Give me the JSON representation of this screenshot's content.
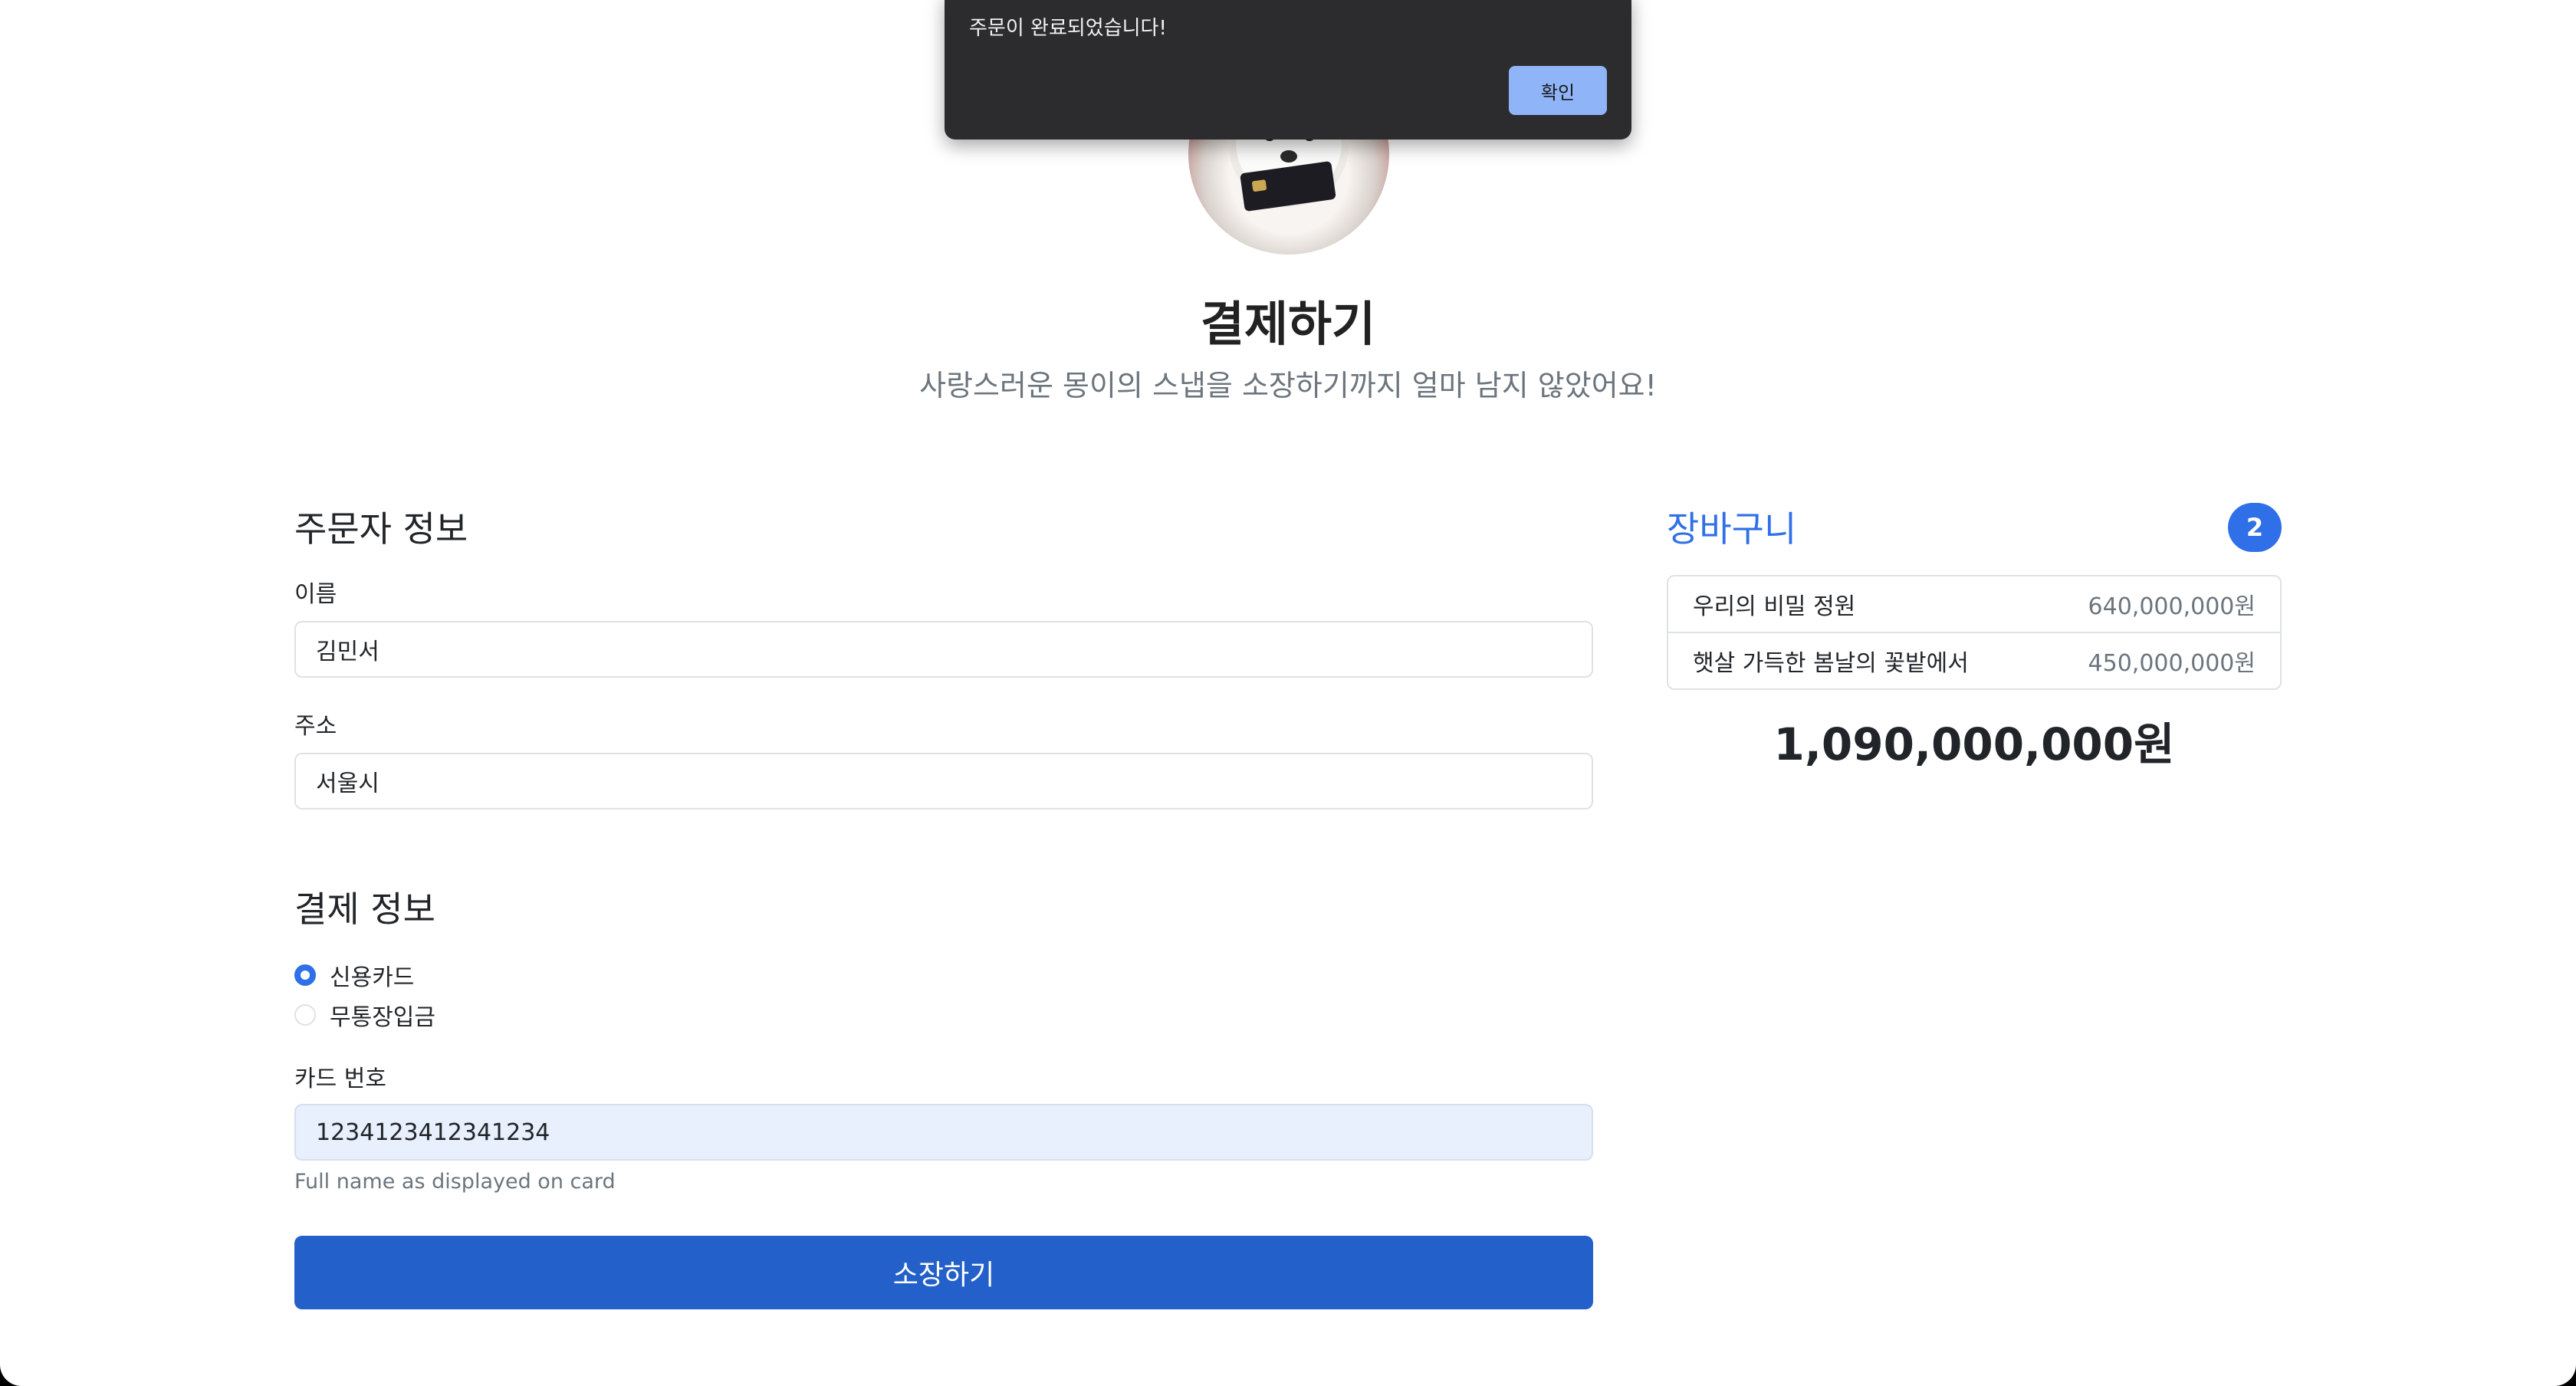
{
  "hero": {
    "title": "결제하기",
    "subtitle": "사랑스러운 몽이의 스냅을 소장하기까지 얼마 남지 않았어요!"
  },
  "orderer": {
    "heading": "주문자 정보",
    "name_label": "이름",
    "name_value": "김민서",
    "address_label": "주소",
    "address_value": "서울시"
  },
  "payment": {
    "heading": "결제 정보",
    "options": [
      {
        "label": "신용카드",
        "checked": true
      },
      {
        "label": "무통장입금",
        "checked": false
      }
    ],
    "card_label": "카드 번호",
    "card_value": "1234123412341234",
    "card_help": "Full name as displayed on card",
    "submit_label": "소장하기"
  },
  "cart": {
    "title": "장바구니",
    "count": "2",
    "items": [
      {
        "name": "우리의 비밀 정원",
        "price": "640,000,000원"
      },
      {
        "name": "햇살 가득한 봄날의 꽃밭에서",
        "price": "450,000,000원"
      }
    ],
    "total": "1,090,000,000원"
  },
  "dialog": {
    "message": "주문이 완료되었습니다!",
    "ok_label": "확인"
  },
  "colors": {
    "primary": "#2f6fe8",
    "submit": "#2360c9",
    "dialog_bg": "#2c2c2e",
    "dialog_button": "#8fb4f7"
  }
}
